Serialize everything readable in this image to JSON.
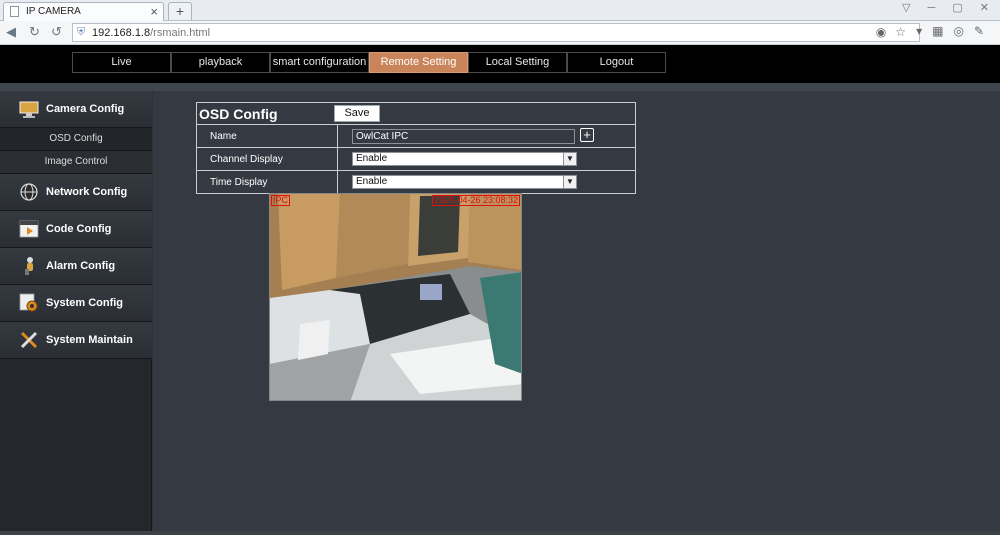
{
  "browser": {
    "tab_title": "IP CAMERA",
    "tab_close": "×",
    "new_tab": "+",
    "url_host": "192.168.1.8",
    "url_path": "/rsmain.html",
    "icons": [
      "back-icon",
      "forward-icon",
      "reload-icon",
      "shield-icon",
      "star-icon",
      "dropdown-icon",
      "menu-icon",
      "zoom-icon",
      "settings-icon"
    ]
  },
  "menu": {
    "items": [
      {
        "label": "Live",
        "active": false
      },
      {
        "label": "playback",
        "active": false
      },
      {
        "label": "smart configuration",
        "active": false
      },
      {
        "label": "Remote Setting",
        "active": true
      },
      {
        "label": "Local Setting",
        "active": false
      },
      {
        "label": "Logout",
        "active": false
      }
    ]
  },
  "sidebar": {
    "camera_config": "Camera Config",
    "sub_items": [
      "OSD Config",
      "Image Control"
    ],
    "network_config": "Network Config",
    "code_config": "Code Config",
    "alarm_config": "Alarm Config",
    "system_config": "System Config",
    "system_maintain": "System Maintain"
  },
  "osd": {
    "title": "OSD Config",
    "save_label": "Save",
    "name_label": "Name",
    "name_value": "OwlCat IPC",
    "plus_label": "+",
    "channel_display_label": "Channel Display",
    "channel_display_value": "Enable",
    "time_display_label": "Time Display",
    "time_display_value": "Enable",
    "select_arrow": "▼"
  },
  "preview": {
    "name_overlay": "IPC",
    "time_overlay": "2020-04-26 23:08:32"
  },
  "colors": {
    "active_menu": "#c9845a",
    "overlay_red": "#e01010",
    "content_bg": "#353a42"
  }
}
